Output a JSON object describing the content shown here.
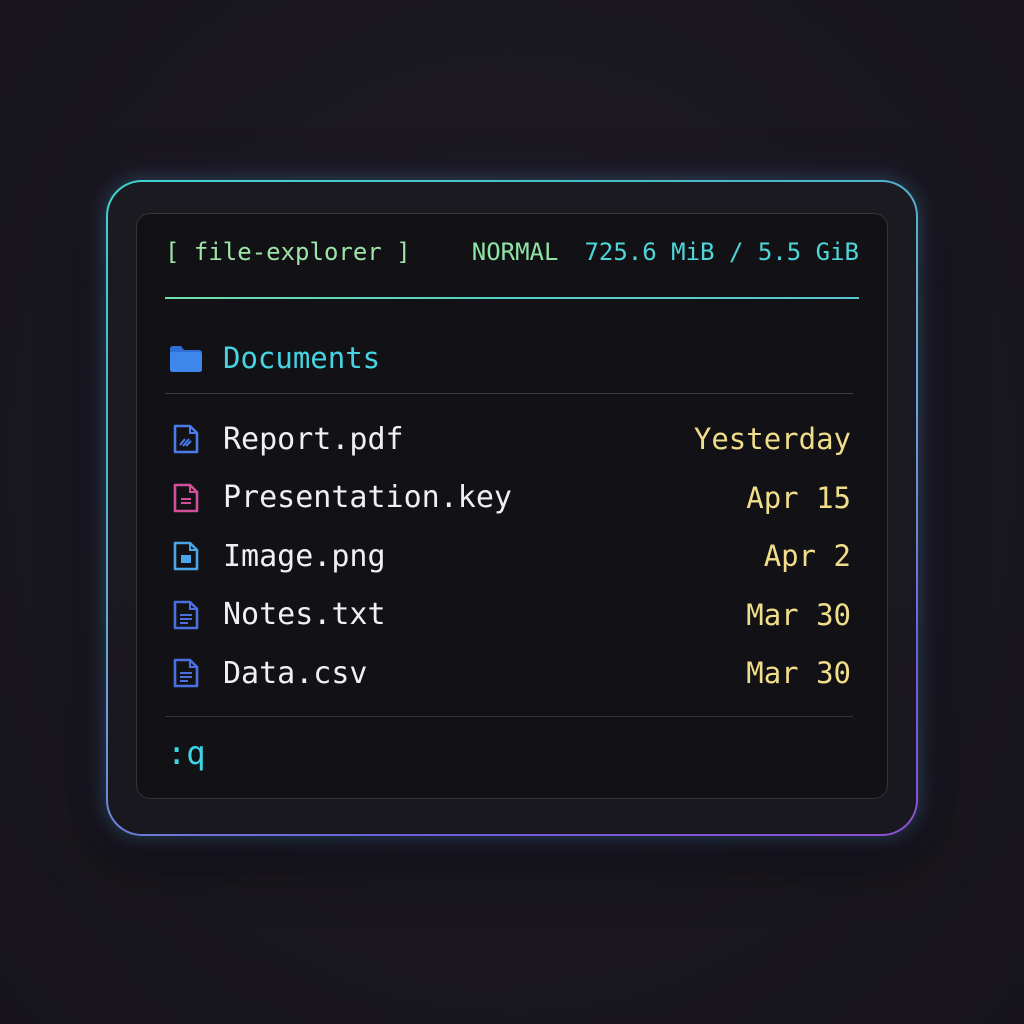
{
  "window": {
    "title": "[ file-explorer ]",
    "mode": "NORMAL",
    "memory": "725.6 MiB / 5.5 GiB"
  },
  "folder": {
    "name": "Documents",
    "icon": "folder-icon"
  },
  "files": [
    {
      "name": "Report.pdf",
      "date": "Yesterday",
      "icon": "pdf-file-icon",
      "color": "#4a7be8"
    },
    {
      "name": "Presentation.key",
      "date": "Apr 15",
      "icon": "presentation-file-icon",
      "color": "#d24f9b"
    },
    {
      "name": "Image.png",
      "date": "Apr 2",
      "icon": "image-file-icon",
      "color": "#4aa6e8"
    },
    {
      "name": "Notes.txt",
      "date": "Mar 30",
      "icon": "text-file-icon",
      "color": "#4a6fe0"
    },
    {
      "name": "Data.csv",
      "date": "Mar 30",
      "icon": "csv-file-icon",
      "color": "#4a6fe0"
    }
  ],
  "command": ":q",
  "colors": {
    "accent_cyan": "#46d3e2",
    "accent_green": "#8fe3a6",
    "date_yellow": "#f1de8a",
    "text": "#f0f0f2",
    "background": "#121216"
  }
}
